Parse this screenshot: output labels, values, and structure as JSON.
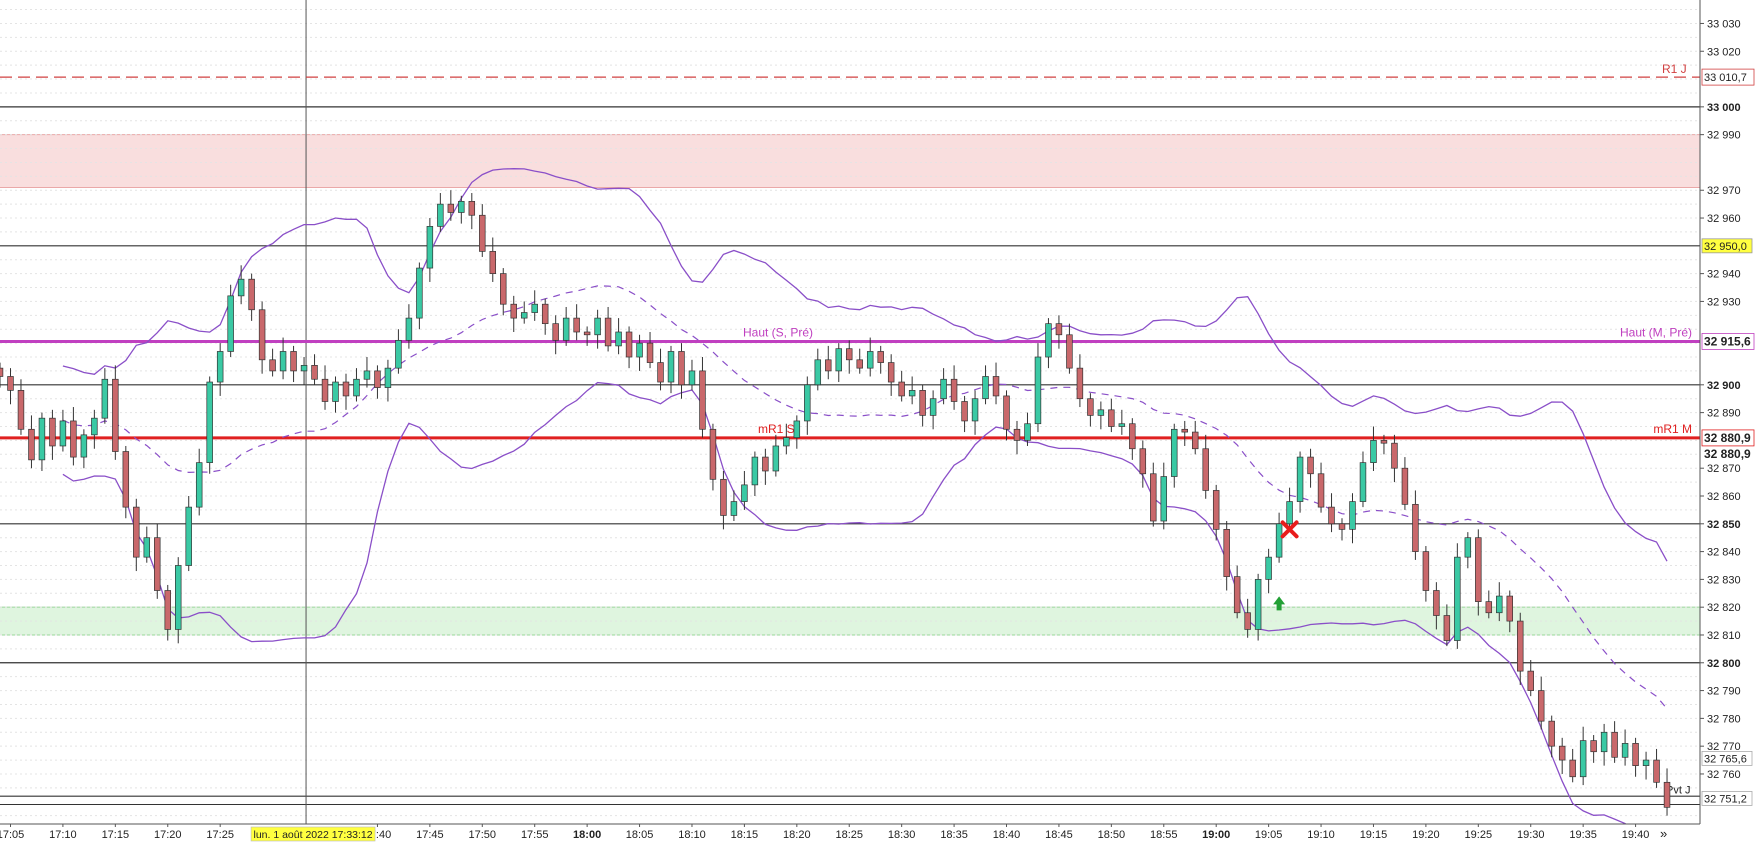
{
  "chart_data": {
    "type": "candlestick",
    "ylim": [
      32742,
      33037
    ],
    "time_range": [
      "17:04",
      "19:45"
    ],
    "colors": {
      "up_candle": "#3ac9a4",
      "down_candle": "#c9686b",
      "bollinger": "#8a4fc8",
      "haut_line": "#c040c0",
      "mr1_line": "#e02020",
      "r1_line": "#d04040",
      "resistance_zone": "#f9dede",
      "support_zone": "#dff5df",
      "time_highlight": "#ffff40"
    },
    "y_ticks": [
      {
        "v": 33030,
        "label": "33 030"
      },
      {
        "v": 33020,
        "label": "33 020"
      },
      {
        "v": 33000,
        "label": "33 000",
        "bold": true
      },
      {
        "v": 32990,
        "label": "32 990"
      },
      {
        "v": 32970,
        "label": "32 970"
      },
      {
        "v": 32960,
        "label": "32 960"
      },
      {
        "v": 32940,
        "label": "32 940"
      },
      {
        "v": 32930,
        "label": "32 930"
      },
      {
        "v": 32900,
        "label": "32 900",
        "bold": true
      },
      {
        "v": 32890,
        "label": "32 890"
      },
      {
        "v": 32870,
        "label": "32 870"
      },
      {
        "v": 32860,
        "label": "32 860"
      },
      {
        "v": 32850,
        "label": "32 850",
        "bold": true
      },
      {
        "v": 32840,
        "label": "32 840"
      },
      {
        "v": 32830,
        "label": "32 830"
      },
      {
        "v": 32820,
        "label": "32 820"
      },
      {
        "v": 32810,
        "label": "32 810"
      },
      {
        "v": 32800,
        "label": "32 800",
        "bold": true
      },
      {
        "v": 32790,
        "label": "32 790"
      },
      {
        "v": 32780,
        "label": "32 780"
      },
      {
        "v": 32770,
        "label": "32 770"
      },
      {
        "v": 32760,
        "label": "32 760"
      }
    ],
    "x_ticks": [
      {
        "t": "17:05",
        "label": "17:05"
      },
      {
        "t": "17:10",
        "label": "17:10"
      },
      {
        "t": "17:15",
        "label": "17:15"
      },
      {
        "t": "17:20",
        "label": "17:20"
      },
      {
        "t": "17:25",
        "label": "17:25"
      },
      {
        "t": "17:40",
        "label": "17:40"
      },
      {
        "t": "17:45",
        "label": "17:45"
      },
      {
        "t": "17:50",
        "label": "17:50"
      },
      {
        "t": "17:55",
        "label": "17:55"
      },
      {
        "t": "18:00",
        "label": "18:00",
        "bold": true
      },
      {
        "t": "18:05",
        "label": "18:05"
      },
      {
        "t": "18:10",
        "label": "18:10"
      },
      {
        "t": "18:15",
        "label": "18:15"
      },
      {
        "t": "18:20",
        "label": "18:20"
      },
      {
        "t": "18:25",
        "label": "18:25"
      },
      {
        "t": "18:30",
        "label": "18:30"
      },
      {
        "t": "18:35",
        "label": "18:35"
      },
      {
        "t": "18:40",
        "label": "18:40"
      },
      {
        "t": "18:45",
        "label": "18:45"
      },
      {
        "t": "18:50",
        "label": "18:50"
      },
      {
        "t": "18:55",
        "label": "18:55"
      },
      {
        "t": "19:00",
        "label": "19:00",
        "bold": true
      },
      {
        "t": "19:05",
        "label": "19:05"
      },
      {
        "t": "19:10",
        "label": "19:10"
      },
      {
        "t": "19:15",
        "label": "19:15"
      },
      {
        "t": "19:20",
        "label": "19:20"
      },
      {
        "t": "19:25",
        "label": "19:25"
      },
      {
        "t": "19:30",
        "label": "19:30"
      },
      {
        "t": "19:35",
        "label": "19:35"
      },
      {
        "t": "19:40",
        "label": "19:40"
      }
    ],
    "crosshair": {
      "t": "17:33",
      "label": "lun. 1 août 2022 17:33:12"
    },
    "zones": [
      {
        "name": "resistance",
        "from": 32971,
        "to": 32990
      },
      {
        "name": "support",
        "from": 32810,
        "to": 32820
      }
    ],
    "round_levels": [
      33000,
      32950,
      32900,
      32850,
      32800,
      32752
    ],
    "levels": [
      {
        "name": "R1 J",
        "v": 33010.7,
        "label": "R1 J",
        "price_label": "33 010,7",
        "style": "dashed"
      },
      {
        "name": "Haut",
        "v": 32915.6,
        "label_left": "Haut (S, Pré)",
        "label_right": "Haut (M, Pré)",
        "price_label": "32 915,6",
        "style": "thick"
      },
      {
        "name": "mR1",
        "v": 32880.9,
        "label_left": "mR1 S",
        "label_right": "mR1 M",
        "price_label": "32 880,9",
        "style": "thick"
      }
    ],
    "price_boxes": [
      {
        "v": 32950,
        "label": "32 950,0"
      },
      {
        "v": 32765.6,
        "label": "32 765,6"
      },
      {
        "v": 32751.2,
        "label": "32 751,2"
      }
    ],
    "last_price_label": "32 880,9",
    "bottom_label": "Pvt J",
    "markers": [
      {
        "type": "cross",
        "t": "19:07",
        "v": 32848
      },
      {
        "type": "arrow-up",
        "t": "19:06",
        "v": 32821
      }
    ],
    "close_series": [
      [
        17,
        4,
        32903
      ],
      [
        17,
        5,
        32898
      ],
      [
        17,
        6,
        32884
      ],
      [
        17,
        7,
        32873
      ],
      [
        17,
        8,
        32888
      ],
      [
        17,
        9,
        32878
      ],
      [
        17,
        10,
        32887
      ],
      [
        17,
        11,
        32874
      ],
      [
        17,
        12,
        32882
      ],
      [
        17,
        13,
        32888
      ],
      [
        17,
        14,
        32902
      ],
      [
        17,
        15,
        32876
      ],
      [
        17,
        16,
        32856
      ],
      [
        17,
        17,
        32838
      ],
      [
        17,
        18,
        32845
      ],
      [
        17,
        19,
        32826
      ],
      [
        17,
        20,
        32812
      ],
      [
        17,
        21,
        32835
      ],
      [
        17,
        22,
        32856
      ],
      [
        17,
        23,
        32872
      ],
      [
        17,
        24,
        32901
      ],
      [
        17,
        25,
        32912
      ],
      [
        17,
        26,
        32932
      ],
      [
        17,
        27,
        32938
      ],
      [
        17,
        28,
        32927
      ],
      [
        17,
        29,
        32909
      ],
      [
        17,
        30,
        32905
      ],
      [
        17,
        31,
        32912
      ],
      [
        17,
        32,
        32905
      ],
      [
        17,
        33,
        32907
      ],
      [
        17,
        34,
        32902
      ],
      [
        17,
        35,
        32894
      ],
      [
        17,
        36,
        32901
      ],
      [
        17,
        37,
        32896
      ],
      [
        17,
        38,
        32902
      ],
      [
        17,
        39,
        32905
      ],
      [
        17,
        40,
        32899
      ],
      [
        17,
        41,
        32906
      ],
      [
        17,
        42,
        32916
      ],
      [
        17,
        43,
        32924
      ],
      [
        17,
        44,
        32942
      ],
      [
        17,
        45,
        32957
      ],
      [
        17,
        46,
        32965
      ],
      [
        17,
        47,
        32962
      ],
      [
        17,
        48,
        32966
      ],
      [
        17,
        49,
        32961
      ],
      [
        17,
        50,
        32948
      ],
      [
        17,
        51,
        32940
      ],
      [
        17,
        52,
        32929
      ],
      [
        17,
        53,
        32924
      ],
      [
        17,
        54,
        32926
      ],
      [
        17,
        55,
        32929
      ],
      [
        17,
        56,
        32922
      ],
      [
        17,
        57,
        32916
      ],
      [
        17,
        58,
        32924
      ],
      [
        17,
        59,
        32919
      ],
      [
        18,
        0,
        32918
      ],
      [
        18,
        1,
        32924
      ],
      [
        18,
        2,
        32914
      ],
      [
        18,
        3,
        32919
      ],
      [
        18,
        4,
        32910
      ],
      [
        18,
        5,
        32915
      ],
      [
        18,
        6,
        32908
      ],
      [
        18,
        7,
        32901
      ],
      [
        18,
        8,
        32912
      ],
      [
        18,
        9,
        32900
      ],
      [
        18,
        10,
        32905
      ],
      [
        18,
        11,
        32884
      ],
      [
        18,
        12,
        32866
      ],
      [
        18,
        13,
        32853
      ],
      [
        18,
        14,
        32858
      ],
      [
        18,
        15,
        32864
      ],
      [
        18,
        16,
        32874
      ],
      [
        18,
        17,
        32869
      ],
      [
        18,
        18,
        32878
      ],
      [
        18,
        19,
        32881
      ],
      [
        18,
        20,
        32887
      ],
      [
        18,
        21,
        32900
      ],
      [
        18,
        22,
        32909
      ],
      [
        18,
        23,
        32905
      ],
      [
        18,
        24,
        32913
      ],
      [
        18,
        25,
        32909
      ],
      [
        18,
        26,
        32906
      ],
      [
        18,
        27,
        32912
      ],
      [
        18,
        28,
        32908
      ],
      [
        18,
        29,
        32901
      ],
      [
        18,
        30,
        32896
      ],
      [
        18,
        31,
        32898
      ],
      [
        18,
        32,
        32889
      ],
      [
        18,
        33,
        32895
      ],
      [
        18,
        34,
        32902
      ],
      [
        18,
        35,
        32894
      ],
      [
        18,
        36,
        32887
      ],
      [
        18,
        37,
        32895
      ],
      [
        18,
        38,
        32903
      ],
      [
        18,
        39,
        32896
      ],
      [
        18,
        40,
        32884
      ],
      [
        18,
        41,
        32880
      ],
      [
        18,
        42,
        32886
      ],
      [
        18,
        43,
        32910
      ],
      [
        18,
        44,
        32922
      ],
      [
        18,
        45,
        32918
      ],
      [
        18,
        46,
        32906
      ],
      [
        18,
        47,
        32895
      ],
      [
        18,
        48,
        32889
      ],
      [
        18,
        49,
        32891
      ],
      [
        18,
        50,
        32885
      ],
      [
        18,
        51,
        32886
      ],
      [
        18,
        52,
        32877
      ],
      [
        18,
        53,
        32868
      ],
      [
        18,
        54,
        32851
      ],
      [
        18,
        55,
        32867
      ],
      [
        18,
        56,
        32884
      ],
      [
        18,
        57,
        32883
      ],
      [
        18,
        58,
        32877
      ],
      [
        18,
        59,
        32862
      ],
      [
        19,
        0,
        32848
      ],
      [
        19,
        1,
        32831
      ],
      [
        19,
        2,
        32818
      ],
      [
        19,
        3,
        32812
      ],
      [
        19,
        4,
        32830
      ],
      [
        19,
        5,
        32838
      ],
      [
        19,
        6,
        32850
      ],
      [
        19,
        7,
        32858
      ],
      [
        19,
        8,
        32874
      ],
      [
        19,
        9,
        32868
      ],
      [
        19,
        10,
        32856
      ],
      [
        19,
        11,
        32850
      ],
      [
        19,
        12,
        32848
      ],
      [
        19,
        13,
        32858
      ],
      [
        19,
        14,
        32872
      ],
      [
        19,
        15,
        32880
      ],
      [
        19,
        16,
        32879
      ],
      [
        19,
        17,
        32870
      ],
      [
        19,
        18,
        32857
      ],
      [
        19,
        19,
        32840
      ],
      [
        19,
        20,
        32826
      ],
      [
        19,
        21,
        32817
      ],
      [
        19,
        22,
        32808
      ],
      [
        19,
        23,
        32838
      ],
      [
        19,
        24,
        32845
      ],
      [
        19,
        25,
        32822
      ],
      [
        19,
        26,
        32818
      ],
      [
        19,
        27,
        32824
      ],
      [
        19,
        28,
        32815
      ],
      [
        19,
        29,
        32797
      ],
      [
        19,
        30,
        32790
      ],
      [
        19,
        31,
        32779
      ],
      [
        19,
        32,
        32770
      ],
      [
        19,
        33,
        32765
      ],
      [
        19,
        34,
        32759
      ],
      [
        19,
        35,
        32772
      ],
      [
        19,
        36,
        32768
      ],
      [
        19,
        37,
        32775
      ],
      [
        19,
        38,
        32766
      ],
      [
        19,
        39,
        32771
      ],
      [
        19,
        40,
        32763
      ],
      [
        19,
        41,
        32765
      ],
      [
        19,
        42,
        32757
      ],
      [
        19,
        43,
        32748
      ]
    ]
  }
}
